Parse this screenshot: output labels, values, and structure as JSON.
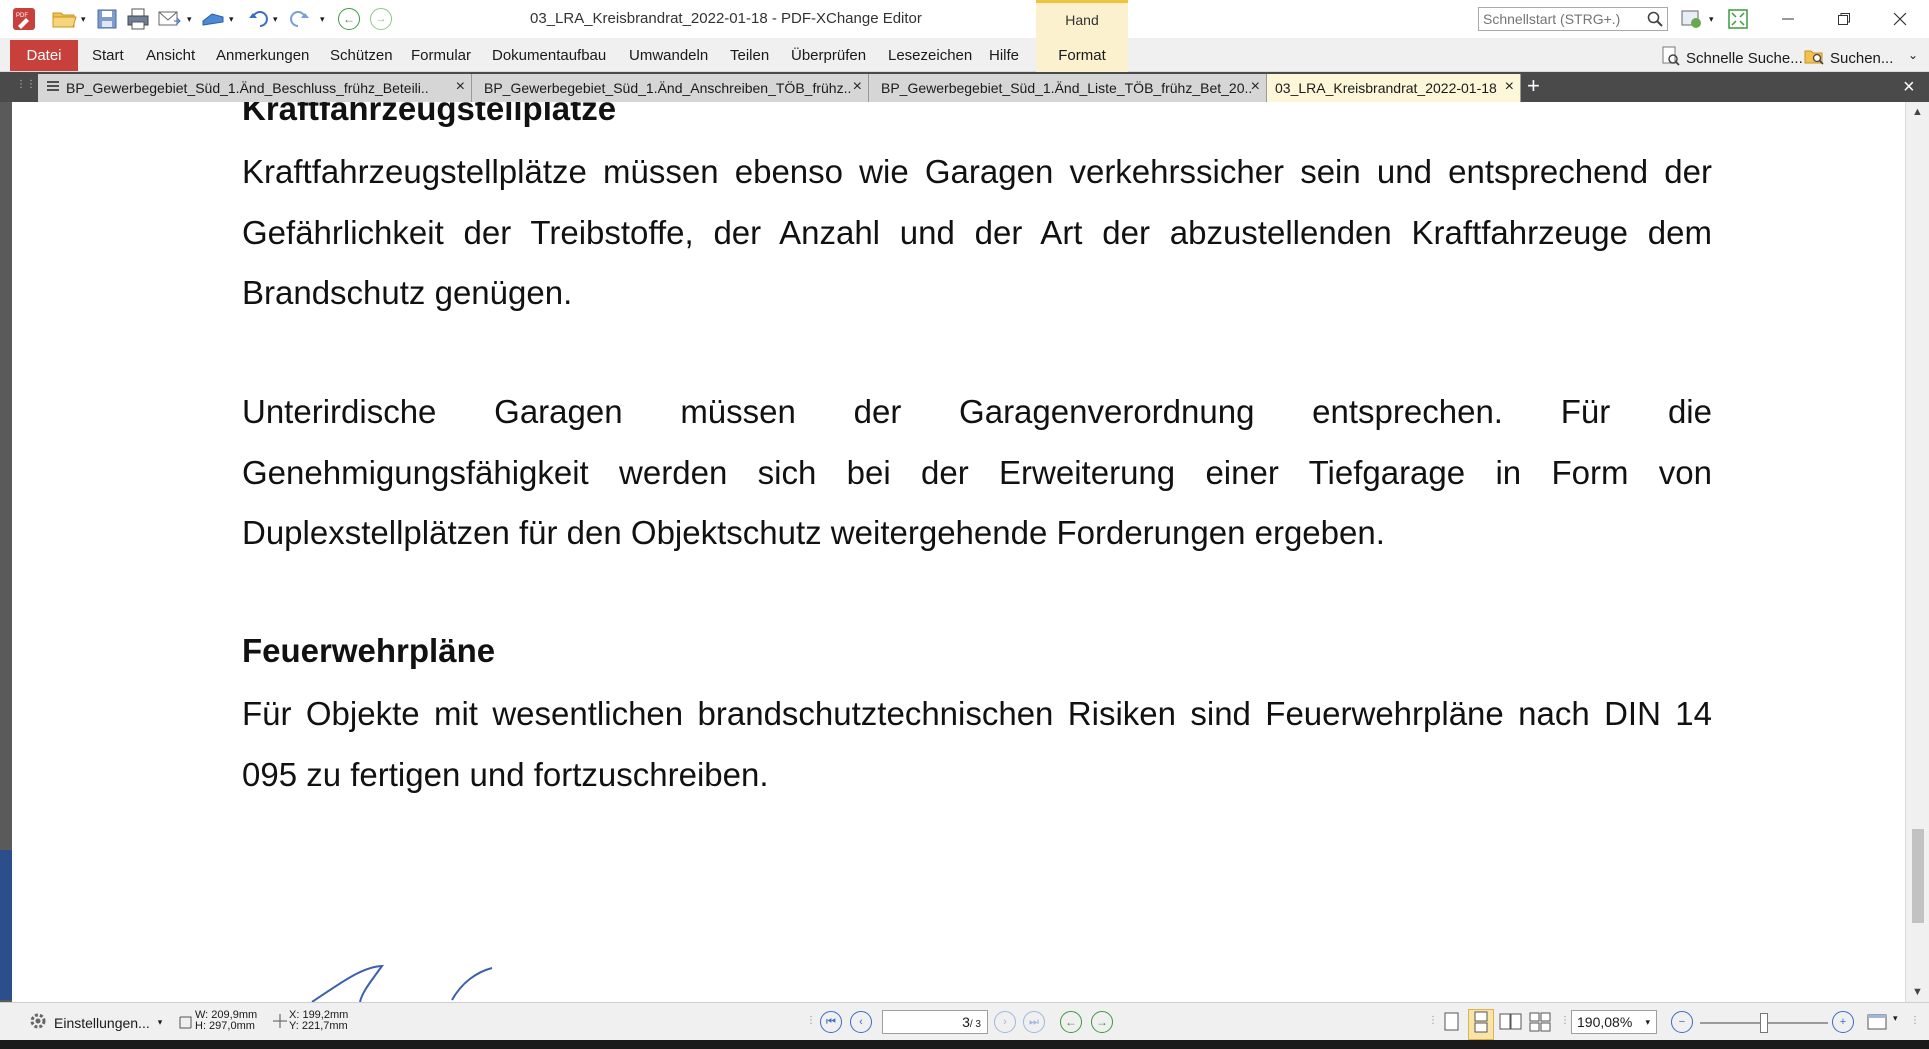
{
  "window": {
    "title": "03_LRA_Kreisbrandrat_2022-01-18 - PDF-XChange Editor",
    "context_group": "Hand",
    "context_tab": "Format",
    "quick_start_placeholder": "Schnellstart (STRG+.)"
  },
  "ribbon": {
    "file": "Datei",
    "tabs": [
      "Start",
      "Ansicht",
      "Anmerkungen",
      "Schützen",
      "Formular",
      "Dokumentaufbau",
      "Umwandeln",
      "Teilen",
      "Überprüfen",
      "Lesezeichen",
      "Hilfe"
    ],
    "quick_search": "Schnelle Suche...",
    "search": "Suchen..."
  },
  "doc_tabs": [
    {
      "label": "BP_Gewerbegebiet_Süd_1.Änd_Beschluss_frühz_Beteili..",
      "active": false
    },
    {
      "label": "BP_Gewerbegebiet_Süd_1.Änd_Anschreiben_TÖB_frühz..",
      "active": false
    },
    {
      "label": "BP_Gewerbegebiet_Süd_1.Änd_Liste_TÖB_frühz_Bet_20..",
      "active": false
    },
    {
      "label": "03_LRA_Kreisbrandrat_2022-01-18",
      "active": true
    }
  ],
  "document": {
    "heading1": "Kraftfahrzeugstellplätze",
    "para1": "Kraftfahrzeugstellplätze müssen ebenso wie Garagen verkehrssicher sein und entsprechend der Gefährlichkeit der Treibstoffe, der Anzahl und der Art der abzustellenden Kraftfahrzeuge dem Brandschutz genügen.",
    "para2": "Unterirdische Garagen müssen der Garagenverordnung entsprechen. Für die Genehmigungsfähigkeit werden sich bei der Erweiterung einer Tiefgarage in Form von Duplexstellplätzen für den Objektschutz weitergehende Forderungen ergeben.",
    "heading2": "Feuerwehrpläne",
    "para3": "Für Objekte mit wesentlichen brandschutztechnischen Risiken sind Feuerwehrpläne nach DIN 14 095 zu fertigen und fortzuschreiben."
  },
  "status": {
    "settings": "Einstellungen...",
    "width": "W: 209,9mm",
    "height": "H: 297,0mm",
    "cursor_x": "X: 199,2mm",
    "cursor_y": "Y: 221,7mm",
    "page_current": "3",
    "page_total": "/ 3",
    "zoom": "190,08%",
    "zoom_slider_fraction": 0.5
  },
  "colors": {
    "file_tab": "#c8403b",
    "context_tab": "#fbf1cf",
    "active_doc_tab": "#fdf6d8",
    "tab_strip": "#4a4a4a"
  }
}
